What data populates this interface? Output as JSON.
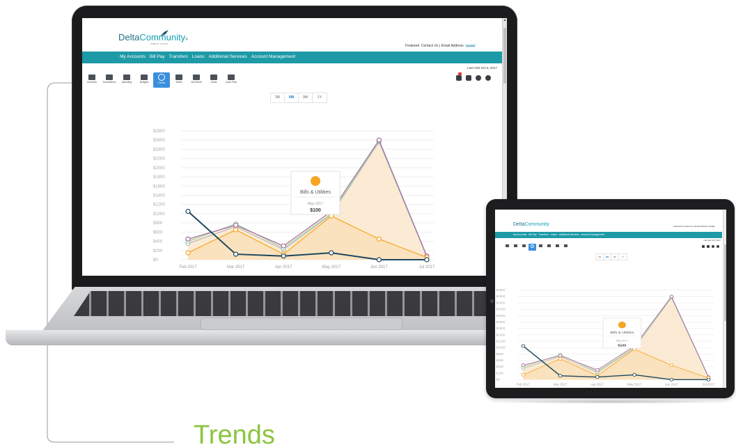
{
  "brand": {
    "logo_word_1": "Delta",
    "logo_word_2": "Community",
    "logo_tm": "®",
    "logo_sub": "CREDIT UNION"
  },
  "header": {
    "featured": "Featured",
    "contact": "Contact Us",
    "separator": "|",
    "email_label": "Email Address",
    "update": "Update"
  },
  "nav": {
    "items": [
      {
        "label": "My Accounts"
      },
      {
        "label": "Bill Pay"
      },
      {
        "label": "Transfers"
      },
      {
        "label": "Loans"
      },
      {
        "label": "Additional Services"
      },
      {
        "label": "Account Management"
      }
    ]
  },
  "last_visit": "Last Visit Oct 6, 2017",
  "toolbar": {
    "tools": [
      {
        "label": "Accounts"
      },
      {
        "label": "Transactions"
      },
      {
        "label": "Spending"
      },
      {
        "label": "Budgets"
      },
      {
        "label": "Trends"
      },
      {
        "label": "Debts"
      },
      {
        "label": "Net Worth"
      },
      {
        "label": "Goals"
      },
      {
        "label": "Cash Flow"
      }
    ],
    "active_index": 4
  },
  "ranges": {
    "options": [
      {
        "label": "3M"
      },
      {
        "label": "6M"
      },
      {
        "label": "9M"
      },
      {
        "label": "1Y"
      }
    ],
    "selected_index": 1
  },
  "tooltip": {
    "category": "Bills & Utilities",
    "month": "May 2017",
    "amount": "$100"
  },
  "colors": {
    "teal_nav": "#1e9aa7",
    "active_tool": "#3a8fdc",
    "orange": "#f5a623",
    "purple": "#a46aa5",
    "green": "#9fd4a0",
    "gray": "#b8bcc2",
    "navy": "#1c4760",
    "fill": "#fbe4c6",
    "trends_green": "#8cc43e"
  },
  "chart_data": {
    "type": "line",
    "x": [
      "Feb 2017",
      "Mar 2017",
      "Apr 2017",
      "May 2017",
      "Jun 2017",
      "Jul 2017"
    ],
    "y_ticks": [
      "$0",
      "$200",
      "$400",
      "$600",
      "$800",
      "$1000",
      "$1200",
      "$1400",
      "$1600",
      "$1800",
      "$2000",
      "$2200",
      "$2400",
      "$2600",
      "$2800"
    ],
    "ylim": [
      0,
      2800
    ],
    "series": [
      {
        "color": "#f5a623",
        "values": [
          150,
          650,
          120,
          950,
          450,
          50
        ],
        "role": "orange"
      },
      {
        "color": "#a46aa5",
        "values": [
          450,
          750,
          300,
          1050,
          2600,
          80
        ],
        "role": "purple"
      },
      {
        "color": "#9fd4a0",
        "values": [
          400,
          780,
          250,
          1000,
          2580,
          70
        ],
        "role": "green"
      },
      {
        "color": "#b8bcc2",
        "values": [
          350,
          720,
          220,
          980,
          2560,
          60
        ],
        "role": "gray"
      },
      {
        "color": "#1c4760",
        "values": [
          1050,
          120,
          80,
          150,
          0,
          0
        ],
        "role": "navy"
      }
    ],
    "fill_series_index": 1,
    "grid": true
  },
  "caption": {
    "title": "Trends"
  }
}
